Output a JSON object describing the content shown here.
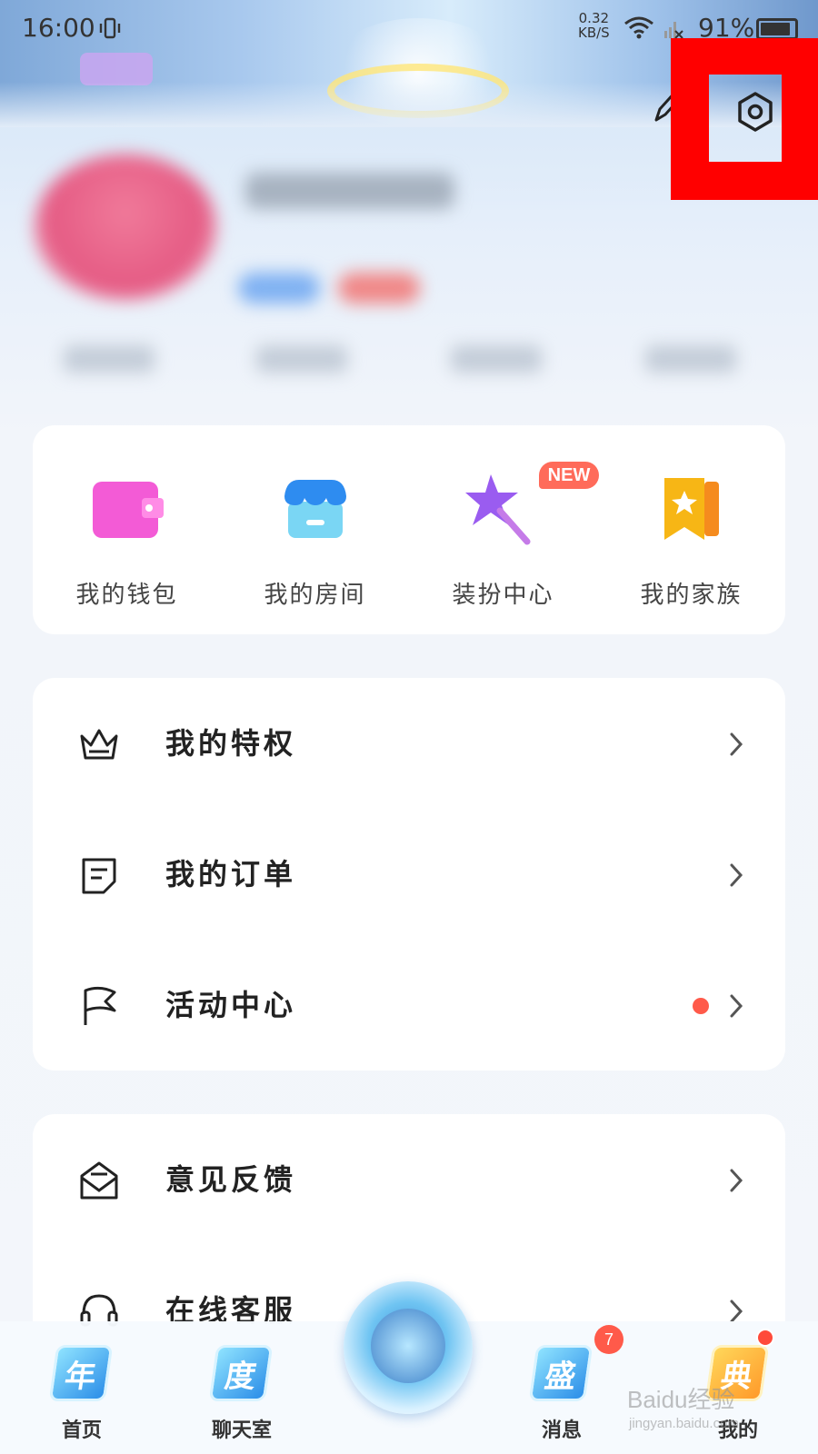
{
  "status_bar": {
    "time": "16:00",
    "net_speed_value": "0.32",
    "net_speed_unit": "KB/S",
    "battery": "91%",
    "battery_level": 0.91
  },
  "header": {
    "icons": [
      "pen-icon",
      "settings-icon"
    ]
  },
  "quick_menu": {
    "items": [
      {
        "label": "我的钱包",
        "icon": "wallet-icon",
        "color": "#f35bd6"
      },
      {
        "label": "我的房间",
        "icon": "shop-room-icon",
        "color": "#2e8cf0"
      },
      {
        "label": "装扮中心",
        "icon": "magic-wand-icon",
        "color": "#9a5cf0",
        "badge": "NEW"
      },
      {
        "label": "我的家族",
        "icon": "family-bookmark-icon",
        "color": "#f7b615"
      }
    ]
  },
  "menu_group_1": {
    "rows": [
      {
        "label": "我的特权",
        "icon": "crown-icon"
      },
      {
        "label": "我的订单",
        "icon": "order-note-icon"
      },
      {
        "label": "活动中心",
        "icon": "flag-icon",
        "dot": true
      }
    ]
  },
  "menu_group_2": {
    "rows": [
      {
        "label": "意见反馈",
        "icon": "feedback-mail-icon"
      },
      {
        "label": "在线客服",
        "icon": "headset-icon"
      }
    ]
  },
  "bottom_nav": {
    "items": [
      {
        "label": "首页",
        "glyph": "年"
      },
      {
        "label": "聊天室",
        "glyph": "度"
      },
      {
        "label": "消息",
        "glyph": "盛",
        "badge": "7"
      },
      {
        "label": "我的",
        "glyph": "典",
        "active": true
      }
    ]
  },
  "watermark": {
    "text": "Baidu经验",
    "sub": "jingyan.baidu.com"
  },
  "colors": {
    "highlight": "#ff0000",
    "accent_red": "#ff5a4a"
  }
}
